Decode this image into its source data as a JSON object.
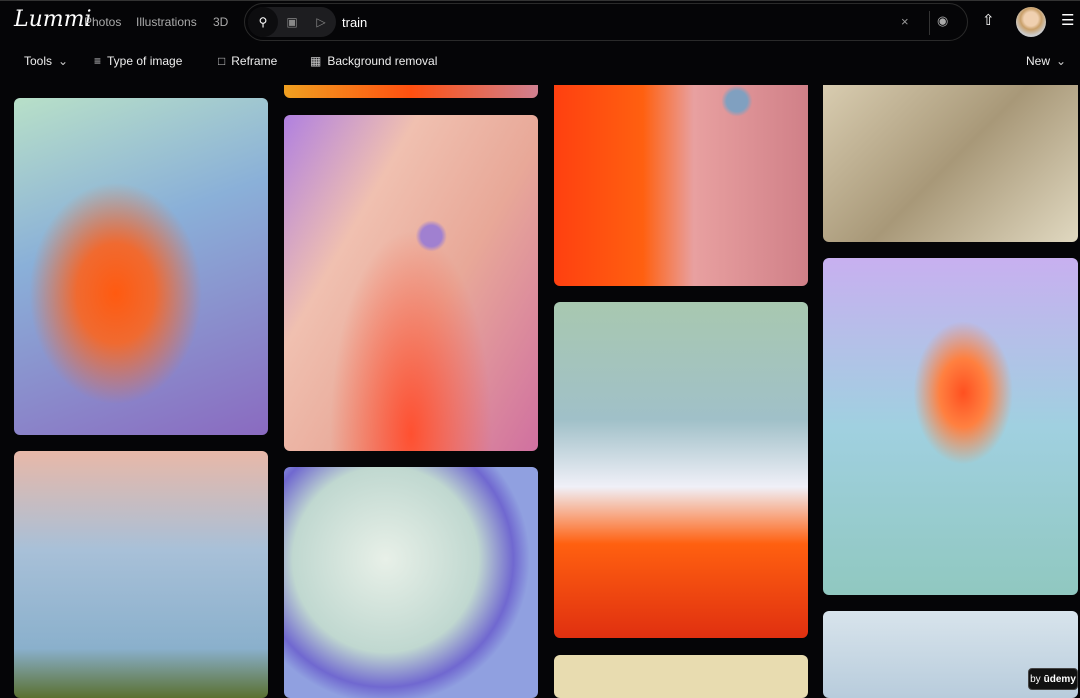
{
  "brand": "Lummi",
  "nav": [
    "Photos",
    "Illustrations",
    "3D"
  ],
  "search": {
    "query": "train",
    "clear_icon": "×",
    "palette_icon": "🎨"
  },
  "toolbar": {
    "tools": "Tools",
    "type": "Type of image",
    "reframe": "Reframe",
    "bg": "Background removal",
    "sort": "New"
  },
  "badge": {
    "by": "by",
    "name": "ūdemy"
  }
}
